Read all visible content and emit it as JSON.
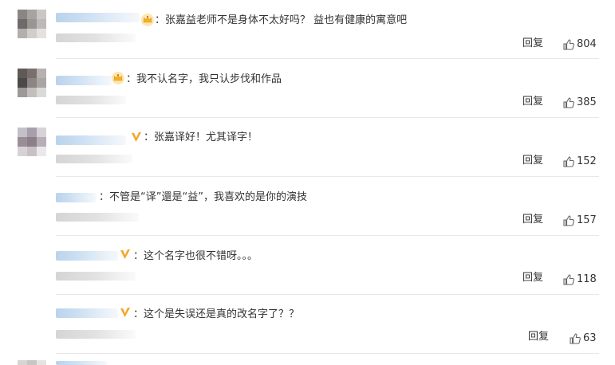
{
  "comments": [
    {
      "text": "：张嘉益老师不是身体不太好吗？ 益也有健康的寓意吧",
      "badge": "crown-icon",
      "reply": "回复",
      "likes": "804"
    },
    {
      "text": "：我不认名字，我只认步伐和作品",
      "badge": "crown-icon",
      "reply": "回复",
      "likes": "385"
    },
    {
      "text": "：张嘉译好！尤其译字！",
      "badge": "v-icon",
      "reply": "回复",
      "likes": "152"
    },
    {
      "text": "：不管是“译”還是“益”，我喜欢的是你的演技",
      "badge": "",
      "reply": "回复",
      "likes": "157"
    },
    {
      "text": "：这个名字也很不错呀。。。",
      "badge": "v-icon",
      "reply": "回复",
      "likes": "118"
    },
    {
      "text": "：这个是失误还是真的改名字了？？",
      "badge": "v-icon",
      "reply": "回复",
      "likes": "63"
    }
  ],
  "colors": {
    "crown": "#f0b428",
    "v_badge": "#f5a623",
    "like_icon": "#666666",
    "divider": "#e8e8e8"
  }
}
